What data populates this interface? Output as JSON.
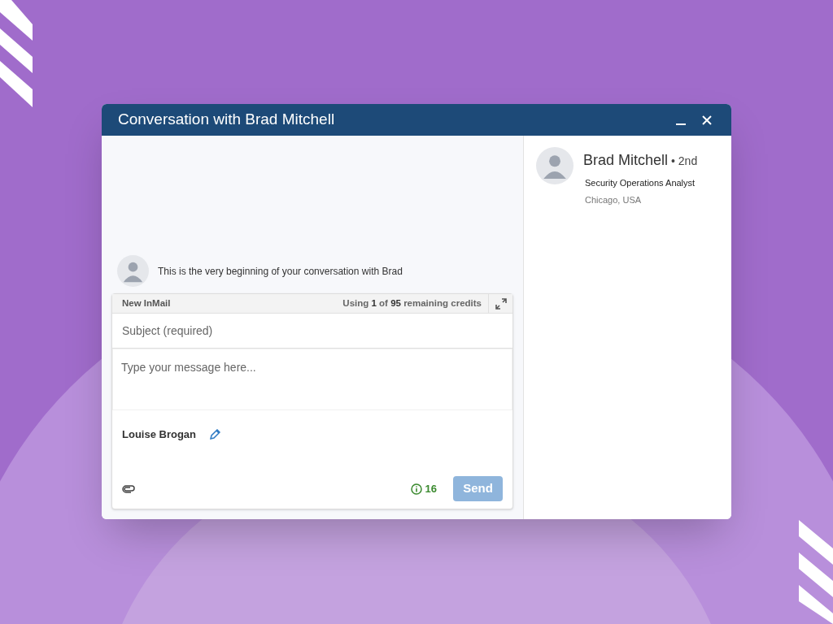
{
  "window": {
    "title": "Conversation with Brad Mitchell"
  },
  "conversation": {
    "intro": "This is the very beginning of your conversation with Brad"
  },
  "compose": {
    "label": "New InMail",
    "credits": "Using **1** of **95** remaining credits",
    "subject": {
      "placeholder": "Subject (required)"
    },
    "message": {
      "placeholder": "Type your message here..."
    },
    "signature": "Louise Brogan",
    "score": "16",
    "send": {
      "label": "Send",
      "disabled": true
    }
  },
  "profile": {
    "name": "Brad Mitchell",
    "degree": "• 2nd",
    "headline": "Security Operations Analyst",
    "location": "Chicago, USA"
  }
}
